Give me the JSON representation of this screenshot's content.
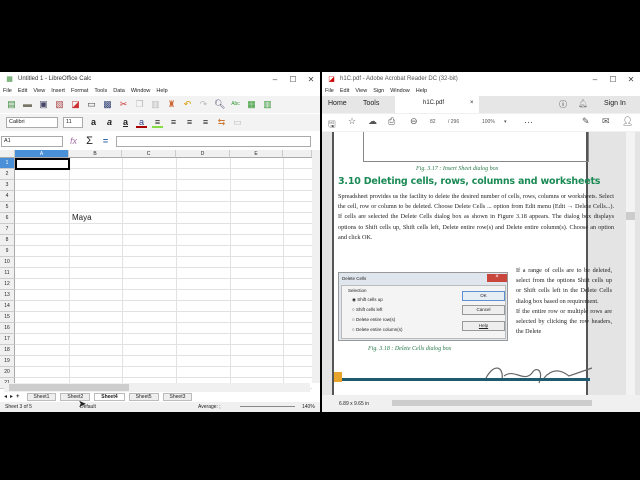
{
  "calc": {
    "title": "Untitled 1 - LibreOffice Calc",
    "menu": [
      "File",
      "Edit",
      "View",
      "Insert",
      "Format",
      "Tools",
      "Data",
      "Window",
      "Help"
    ],
    "font_name": "Calibri",
    "font_size": "11",
    "cell_ref": "A1",
    "columns": [
      "A",
      "B",
      "C",
      "D",
      "E"
    ],
    "rows": [
      "1",
      "2",
      "3",
      "4",
      "5",
      "6",
      "7",
      "8",
      "9",
      "10",
      "11",
      "12",
      "13",
      "14",
      "15",
      "16",
      "17",
      "18",
      "19",
      "20",
      "21"
    ],
    "cell_b6": "Maya",
    "sheets": [
      "Sheet1",
      "Sheet2",
      "Sheet4",
      "Sheet5",
      "Sheet3"
    ],
    "active_sheet": "Sheet4",
    "status": {
      "sheet": "Sheet 3 of 5",
      "style": "Default",
      "sum": "Average: ;",
      "zoom": "140%"
    }
  },
  "acrobat": {
    "title": "h1C.pdf - Adobe Acrobat Reader DC (32-bit)",
    "menu": [
      "File",
      "Edit",
      "View",
      "Sign",
      "Window",
      "Help"
    ],
    "tabs": {
      "home": "Home",
      "tools": "Tools",
      "doc": "h1C.pdf"
    },
    "sign_in": "Sign In",
    "page": "82",
    "page_total": "/ 296",
    "zoom": "100%",
    "status_size": "6.89 x 9.65 in",
    "doc": {
      "fig317": "Fig. 3.17 : Insert Sheet dialog box",
      "heading": "3.10 Deleting cells, rows, columns and worksheets",
      "para1": "Spreadsheet provides us the facility to delete the desired number of cells, rows, columns or worksheets. Select the cell, row or column to be deleted. Choose Delete Cells ... option from Edit menu (Edit → Delete Cells...). If cells are selected the Delete Cells dialog box as shown in Figure 3.18 appears. The dialog box displays options to Shift cells up, Shift cells left, Delete entire row(s) and Delete entire column(s). Choose an option and click OK.",
      "para2": "If a range of cells are to be deleted, select from the options Shift cells up or Shift cells left in the Delete Cells dialog box based on requirement.",
      "para3": "If the entire row or multiple rows are selected by clicking the row headers, the Delete",
      "fig318": "Fig. 3.18 : Delete Cells dialog box",
      "dialog": {
        "title": "Delete Cells",
        "group": "Selection",
        "options": [
          "Shift cells up",
          "Shift cells left",
          "Delete entire row(s)",
          "Delete entire column(s)"
        ],
        "ok": "OK",
        "cancel": "Cancel",
        "help": "Help"
      }
    }
  }
}
